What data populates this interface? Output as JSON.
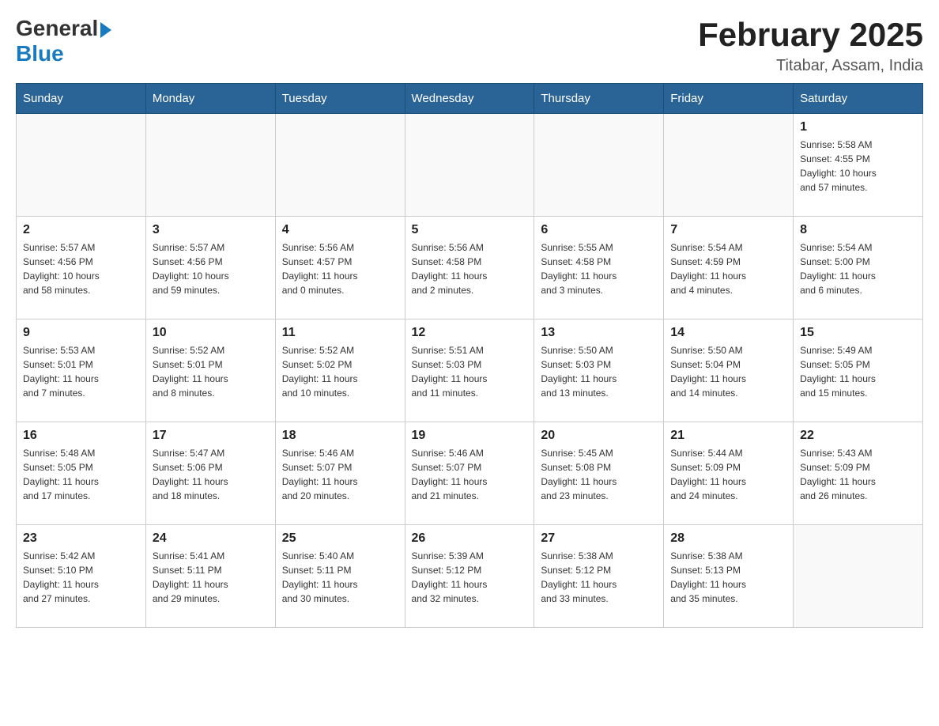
{
  "header": {
    "logo_general": "General",
    "logo_blue": "Blue",
    "month_title": "February 2025",
    "location": "Titabar, Assam, India"
  },
  "weekdays": [
    "Sunday",
    "Monday",
    "Tuesday",
    "Wednesday",
    "Thursday",
    "Friday",
    "Saturday"
  ],
  "weeks": [
    [
      {
        "day": "",
        "info": ""
      },
      {
        "day": "",
        "info": ""
      },
      {
        "day": "",
        "info": ""
      },
      {
        "day": "",
        "info": ""
      },
      {
        "day": "",
        "info": ""
      },
      {
        "day": "",
        "info": ""
      },
      {
        "day": "1",
        "info": "Sunrise: 5:58 AM\nSunset: 4:55 PM\nDaylight: 10 hours\nand 57 minutes."
      }
    ],
    [
      {
        "day": "2",
        "info": "Sunrise: 5:57 AM\nSunset: 4:56 PM\nDaylight: 10 hours\nand 58 minutes."
      },
      {
        "day": "3",
        "info": "Sunrise: 5:57 AM\nSunset: 4:56 PM\nDaylight: 10 hours\nand 59 minutes."
      },
      {
        "day": "4",
        "info": "Sunrise: 5:56 AM\nSunset: 4:57 PM\nDaylight: 11 hours\nand 0 minutes."
      },
      {
        "day": "5",
        "info": "Sunrise: 5:56 AM\nSunset: 4:58 PM\nDaylight: 11 hours\nand 2 minutes."
      },
      {
        "day": "6",
        "info": "Sunrise: 5:55 AM\nSunset: 4:58 PM\nDaylight: 11 hours\nand 3 minutes."
      },
      {
        "day": "7",
        "info": "Sunrise: 5:54 AM\nSunset: 4:59 PM\nDaylight: 11 hours\nand 4 minutes."
      },
      {
        "day": "8",
        "info": "Sunrise: 5:54 AM\nSunset: 5:00 PM\nDaylight: 11 hours\nand 6 minutes."
      }
    ],
    [
      {
        "day": "9",
        "info": "Sunrise: 5:53 AM\nSunset: 5:01 PM\nDaylight: 11 hours\nand 7 minutes."
      },
      {
        "day": "10",
        "info": "Sunrise: 5:52 AM\nSunset: 5:01 PM\nDaylight: 11 hours\nand 8 minutes."
      },
      {
        "day": "11",
        "info": "Sunrise: 5:52 AM\nSunset: 5:02 PM\nDaylight: 11 hours\nand 10 minutes."
      },
      {
        "day": "12",
        "info": "Sunrise: 5:51 AM\nSunset: 5:03 PM\nDaylight: 11 hours\nand 11 minutes."
      },
      {
        "day": "13",
        "info": "Sunrise: 5:50 AM\nSunset: 5:03 PM\nDaylight: 11 hours\nand 13 minutes."
      },
      {
        "day": "14",
        "info": "Sunrise: 5:50 AM\nSunset: 5:04 PM\nDaylight: 11 hours\nand 14 minutes."
      },
      {
        "day": "15",
        "info": "Sunrise: 5:49 AM\nSunset: 5:05 PM\nDaylight: 11 hours\nand 15 minutes."
      }
    ],
    [
      {
        "day": "16",
        "info": "Sunrise: 5:48 AM\nSunset: 5:05 PM\nDaylight: 11 hours\nand 17 minutes."
      },
      {
        "day": "17",
        "info": "Sunrise: 5:47 AM\nSunset: 5:06 PM\nDaylight: 11 hours\nand 18 minutes."
      },
      {
        "day": "18",
        "info": "Sunrise: 5:46 AM\nSunset: 5:07 PM\nDaylight: 11 hours\nand 20 minutes."
      },
      {
        "day": "19",
        "info": "Sunrise: 5:46 AM\nSunset: 5:07 PM\nDaylight: 11 hours\nand 21 minutes."
      },
      {
        "day": "20",
        "info": "Sunrise: 5:45 AM\nSunset: 5:08 PM\nDaylight: 11 hours\nand 23 minutes."
      },
      {
        "day": "21",
        "info": "Sunrise: 5:44 AM\nSunset: 5:09 PM\nDaylight: 11 hours\nand 24 minutes."
      },
      {
        "day": "22",
        "info": "Sunrise: 5:43 AM\nSunset: 5:09 PM\nDaylight: 11 hours\nand 26 minutes."
      }
    ],
    [
      {
        "day": "23",
        "info": "Sunrise: 5:42 AM\nSunset: 5:10 PM\nDaylight: 11 hours\nand 27 minutes."
      },
      {
        "day": "24",
        "info": "Sunrise: 5:41 AM\nSunset: 5:11 PM\nDaylight: 11 hours\nand 29 minutes."
      },
      {
        "day": "25",
        "info": "Sunrise: 5:40 AM\nSunset: 5:11 PM\nDaylight: 11 hours\nand 30 minutes."
      },
      {
        "day": "26",
        "info": "Sunrise: 5:39 AM\nSunset: 5:12 PM\nDaylight: 11 hours\nand 32 minutes."
      },
      {
        "day": "27",
        "info": "Sunrise: 5:38 AM\nSunset: 5:12 PM\nDaylight: 11 hours\nand 33 minutes."
      },
      {
        "day": "28",
        "info": "Sunrise: 5:38 AM\nSunset: 5:13 PM\nDaylight: 11 hours\nand 35 minutes."
      },
      {
        "day": "",
        "info": ""
      }
    ]
  ]
}
